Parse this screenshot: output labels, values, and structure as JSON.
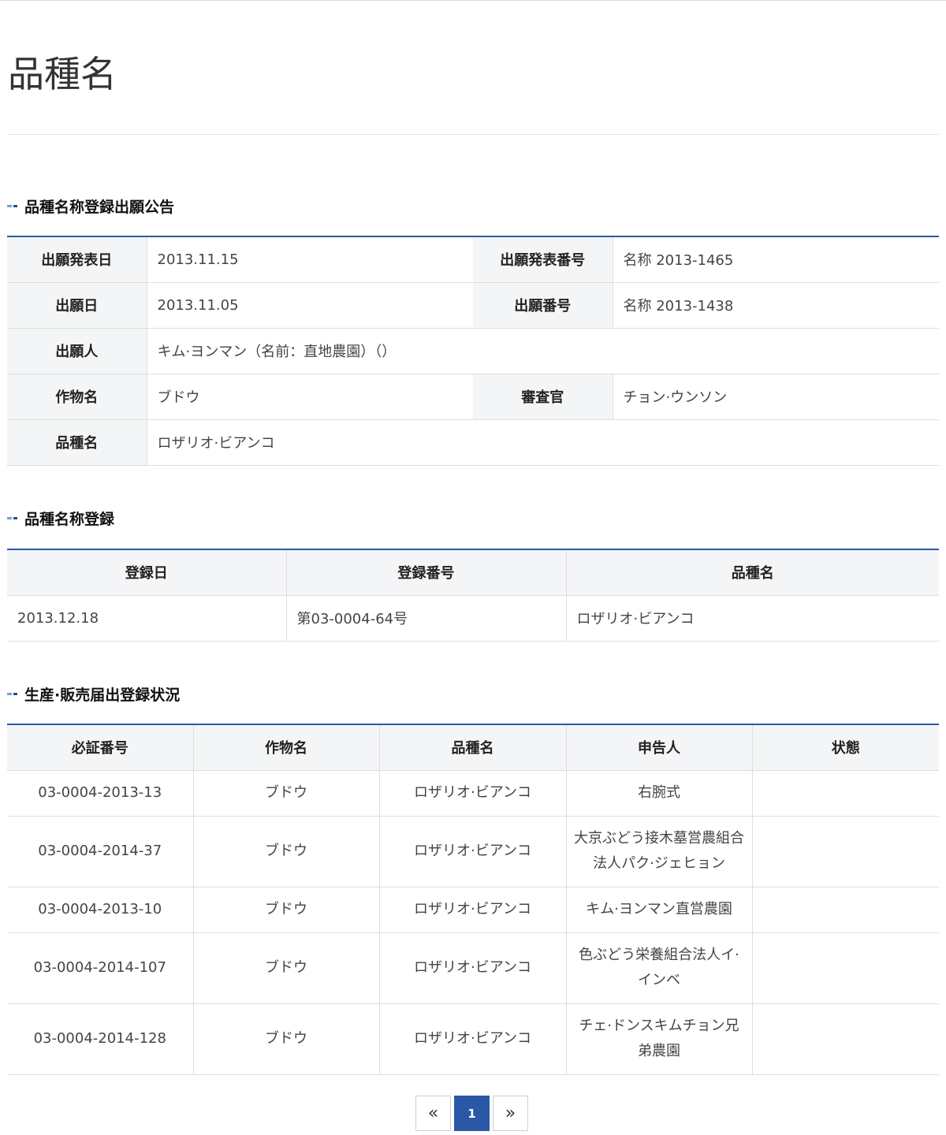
{
  "page": {
    "title": "品種名"
  },
  "section1": {
    "heading": "品種名称登録出願公告",
    "rows": {
      "pub_date_label": "出願発表日",
      "pub_date": "2013.11.15",
      "pub_no_label": "出願発表番号",
      "pub_no": "名称 2013-1465",
      "app_date_label": "出願日",
      "app_date": "2013.11.05",
      "app_no_label": "出願番号",
      "app_no": "名称 2013-1438",
      "applicant_label": "出願人",
      "applicant": "キム·ヨンマン（名前：直地農園）（）",
      "crop_label": "作物名",
      "crop": "ブドウ",
      "examiner_label": "審査官",
      "examiner": "チョン·ウンソン",
      "variety_label": "品種名",
      "variety": "ロザリオ·ビアンコ"
    }
  },
  "section2": {
    "heading": "品種名称登録",
    "headers": [
      "登録日",
      "登録番号",
      "品種名"
    ],
    "row": [
      "2013.12.18",
      "第03-0004-64号",
      "ロザリオ·ビアンコ"
    ]
  },
  "section3": {
    "heading": "生産·販売届出登録状況",
    "headers": [
      "必証番号",
      "作物名",
      "品種名",
      "申告人",
      "状態"
    ],
    "rows": [
      [
        "03-0004-2013-13",
        "ブドウ",
        "ロザリオ·ビアンコ",
        "右腕式",
        ""
      ],
      [
        "03-0004-2014-37",
        "ブドウ",
        "ロザリオ·ビアンコ",
        "大京ぶどう接木墓営農組合法人パク·ジェヒョン",
        ""
      ],
      [
        "03-0004-2013-10",
        "ブドウ",
        "ロザリオ·ビアンコ",
        "キム·ヨンマン直営農園",
        ""
      ],
      [
        "03-0004-2014-107",
        "ブドウ",
        "ロザリオ·ビアンコ",
        "色ぶどう栄養組合法人イ·インベ",
        ""
      ],
      [
        "03-0004-2014-128",
        "ブドウ",
        "ロザリオ·ビアンコ",
        "チェ·ドンスキムチョン兄弟農園",
        ""
      ]
    ]
  },
  "pagination": {
    "prev": "«",
    "current": "1",
    "next": "»"
  }
}
